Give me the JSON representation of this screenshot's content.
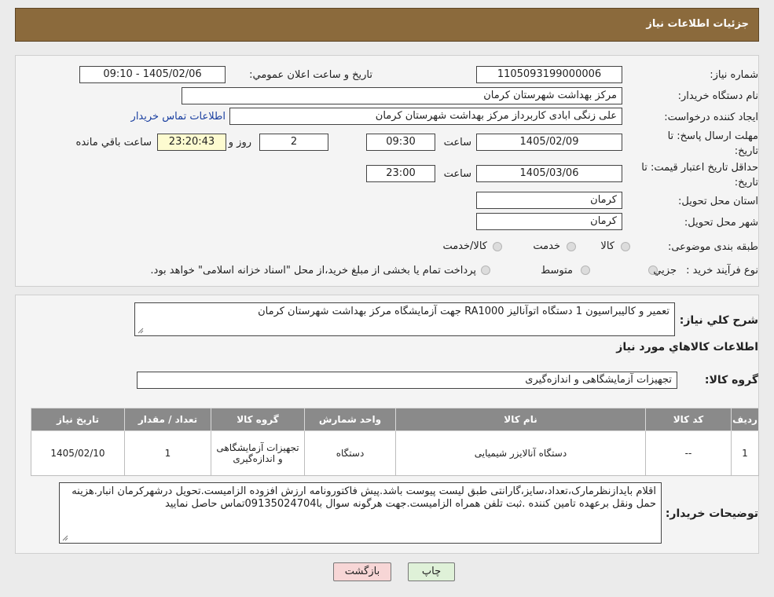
{
  "header": {
    "title": "جزئيات اطلاعات نياز"
  },
  "labels": {
    "need_number": "شماره نياز:",
    "announce_datetime": "تاريخ و ساعت اعلان عمومي:",
    "buyer_org": "نام دستگاه خريدار:",
    "requester": "ايجاد کننده درخواست:",
    "contact_link": "اطلاعات تماس خريدار",
    "deadline_line1": "مهلت ارسال پاسخ: تا",
    "deadline_line2": "تاريخ:",
    "time": "ساعت",
    "day_and": "روز و",
    "remaining": "ساعت باقي مانده",
    "validity_line1": "حداقل تاريخ اعتبار قيمت: تا",
    "validity_line2": "تاريخ:",
    "province": "استان محل تحويل:",
    "city": "شهر محل تحويل:",
    "category": "طبقه بندی موضوعی:",
    "process_type": "نوع فرآيند خريد :",
    "summary": "شرح کلي نياز:",
    "goods_info": "اطلاعات کالاهاي مورد نياز",
    "goods_group": "گروه کالا:",
    "buyer_notes": "توضيحات خريدار:"
  },
  "form": {
    "need_number": "1105093199000006",
    "announce_datetime": "1405/02/06 - 09:10",
    "buyer_org": "مرکز بهداشت شهرستان کرمان",
    "requester": "علی زنگی ابادی کاربرداز مرکز بهداشت شهرستان کرمان",
    "deadline_date": "1405/02/09",
    "deadline_time": "09:30",
    "days": "2",
    "remaining_time": "23:20:43",
    "validity_date": "1405/03/06",
    "validity_time": "23:00",
    "province": "کرمان",
    "city": "کرمان"
  },
  "category_options": [
    "کالا",
    "خدمت",
    "کالا/خدمت"
  ],
  "process_options": [
    "جزيي",
    "متوسط"
  ],
  "process_note": "پرداخت تمام يا بخشی از مبلغ خريد،از محل \"اسناد خزانه اسلامی\" خواهد بود.",
  "summary_text": "تعمير و کاليبراسيون 1 دستگاه اتوآناليز RA1000 جهت آزمايشگاه مرکز بهداشت شهرستان کرمان",
  "goods_group": "تجهيزات آزمايشگاهی و اندازه‌گيری",
  "table": {
    "headers": [
      "رديف",
      "کد کالا",
      "نام کالا",
      "واحد شمارش",
      "گروه کالا",
      "تعداد / مقدار",
      "تاريخ نياز"
    ],
    "rows": [
      [
        "1",
        "--",
        "دستگاه آنالايزر شيميايی",
        "دستگاه",
        "تجهيزات آزمايشگاهی و اندازه‌گيری",
        "1",
        "1405/02/10"
      ]
    ]
  },
  "buyer_notes": "اقلام بايدازنظرمارک،تعداد،سايز،گارانتی طبق ليست پيوست باشد.پيش فاکتورونامه ارزش افزوده الزاميست.تحويل درشهرکرمان انبار.هزينه حمل ونقل برعهده تامين کننده .ثبت تلفن همراه الزاميست.جهت هرگونه سوال با09135024704تماس حاصل نماييد",
  "buttons": {
    "print": "چاپ",
    "back": "بازگشت"
  },
  "icons": [
    "resize-grip-icon"
  ]
}
